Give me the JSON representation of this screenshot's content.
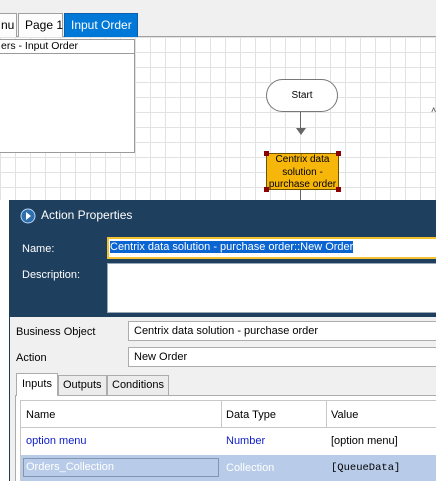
{
  "tabs": [
    {
      "label": "Menu",
      "visible": "nu"
    },
    {
      "label": "Page 1"
    },
    {
      "label": "Input Order",
      "active": true
    }
  ],
  "canvas": {
    "note_title": "ers - Input Order",
    "start_label": "Start",
    "action_label": "Centrix data solution - purchase order"
  },
  "dialog": {
    "title": "Action Properties",
    "name_label": "Name:",
    "name_value": "Centrix data solution - purchase order::New Order",
    "description_label": "Description:",
    "description_value": "",
    "business_object_label": "Business Object",
    "business_object_value": "Centrix data solution - purchase order",
    "action_label": "Action",
    "action_value": "New Order",
    "tabs": [
      "Inputs",
      "Outputs",
      "Conditions"
    ],
    "active_tab": "Inputs",
    "grid": {
      "columns": [
        "Name",
        "Data Type",
        "Value"
      ],
      "rows": [
        {
          "name": "option menu",
          "type": "Number",
          "value": "[option menu]"
        },
        {
          "name": "Orders_Collection",
          "type": "Collection",
          "value": "[QueueData]"
        }
      ]
    }
  },
  "colors": {
    "accent": "#0078d7",
    "dialog_header": "#1e3f5d",
    "action_node": "#f6b60a",
    "selected_row": "#b8cbe8",
    "link_text": "#1020c8"
  }
}
